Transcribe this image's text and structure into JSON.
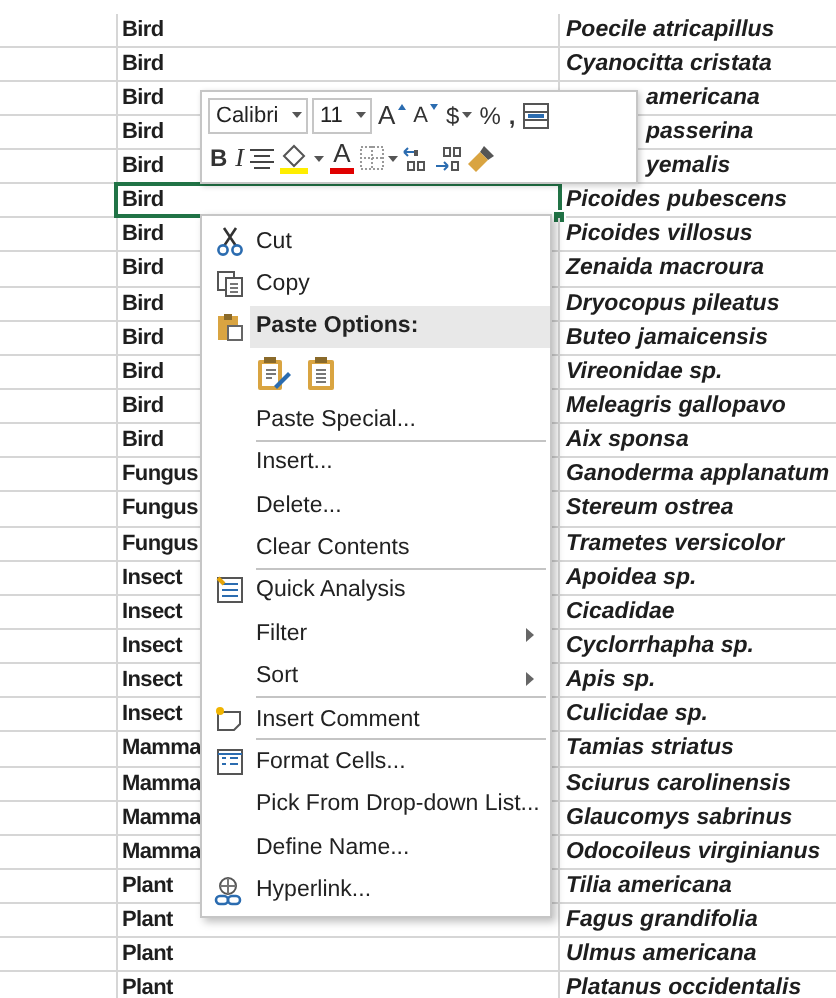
{
  "sheet": {
    "rows": [
      {
        "category": "Bird",
        "species": "Poecile atricapillus",
        "selected": false,
        "covered": false
      },
      {
        "category": "Bird",
        "species": "Cyanocitta cristata",
        "selected": false,
        "covered": false
      },
      {
        "category": "Bird",
        "species": "americana",
        "selected": false,
        "covered": true
      },
      {
        "category": "Bird",
        "species": "passerina",
        "selected": false,
        "covered": true
      },
      {
        "category": "Bird",
        "species": "yemalis",
        "selected": false,
        "covered": true
      },
      {
        "category": "Bird",
        "species": "Picoides pubescens",
        "selected": true,
        "covered": false
      },
      {
        "category": "Bird",
        "species": "Picoides villosus",
        "selected": false,
        "covered": false
      },
      {
        "category": "Bird",
        "species": "Zenaida macroura",
        "selected": false,
        "covered": false
      },
      {
        "category": "Bird",
        "species": "Dryocopus pileatus",
        "selected": false,
        "covered": false
      },
      {
        "category": "Bird",
        "species": "Buteo jamaicensis",
        "selected": false,
        "covered": false
      },
      {
        "category": "Bird",
        "species": "Vireonidae sp.",
        "selected": false,
        "covered": false
      },
      {
        "category": "Bird",
        "species": "Meleagris gallopavo",
        "selected": false,
        "covered": false
      },
      {
        "category": "Bird",
        "species": "Aix sponsa",
        "selected": false,
        "covered": false
      },
      {
        "category": "Fungus",
        "species": "Ganoderma applanatum",
        "selected": false,
        "covered": false
      },
      {
        "category": "Fungus",
        "species": "Stereum ostrea",
        "selected": false,
        "covered": false
      },
      {
        "category": "Fungus",
        "species": "Trametes versicolor",
        "selected": false,
        "covered": false
      },
      {
        "category": "Insect",
        "species": "Apoidea sp.",
        "selected": false,
        "covered": false
      },
      {
        "category": "Insect",
        "species": "Cicadidae",
        "selected": false,
        "covered": false
      },
      {
        "category": "Insect",
        "species": "Cyclorrhapha sp.",
        "selected": false,
        "covered": false
      },
      {
        "category": "Insect",
        "species": "Apis sp.",
        "selected": false,
        "covered": false
      },
      {
        "category": "Insect",
        "species": "Culicidae sp.",
        "selected": false,
        "covered": false
      },
      {
        "category": "Mamma",
        "species": "Tamias striatus",
        "selected": false,
        "covered": false
      },
      {
        "category": "Mamma",
        "species": "Sciurus carolinensis",
        "selected": false,
        "covered": false
      },
      {
        "category": "Mamma",
        "species": "Glaucomys sabrinus",
        "selected": false,
        "covered": false
      },
      {
        "category": "Mamma",
        "species": "Odocoileus virginianus",
        "selected": false,
        "covered": false
      },
      {
        "category": "Plant",
        "species": "Tilia americana",
        "selected": false,
        "covered": false
      },
      {
        "category": "Plant",
        "species": "Fagus grandifolia",
        "selected": false,
        "covered": false
      },
      {
        "category": "Plant",
        "species": "Ulmus americana",
        "selected": false,
        "covered": false
      },
      {
        "category": "Plant",
        "species": "Platanus occidentalis",
        "selected": false,
        "covered": false
      }
    ]
  },
  "mini_toolbar": {
    "rows": [
      {
        "items": [
          {
            "kind": "font",
            "label": "Calibri"
          },
          {
            "kind": "size",
            "label": "11"
          },
          {
            "kind": "grow",
            "label": "A"
          },
          {
            "kind": "shrink",
            "label": "A"
          },
          {
            "kind": "currency",
            "label": "$"
          },
          {
            "kind": "percent",
            "label": "%"
          },
          {
            "kind": "comma",
            "label": ","
          },
          {
            "kind": "table"
          }
        ]
      },
      {
        "items": [
          {
            "kind": "bold",
            "label": "B"
          },
          {
            "kind": "italic",
            "label": "I"
          },
          {
            "kind": "align"
          },
          {
            "kind": "fill",
            "color": "#ffee00"
          },
          {
            "kind": "fontcolor",
            "label": "A",
            "color": "#e00000"
          },
          {
            "kind": "borders"
          },
          {
            "kind": "incdec"
          },
          {
            "kind": "decdec"
          },
          {
            "kind": "painter"
          }
        ]
      }
    ]
  },
  "context_menu": {
    "items": [
      {
        "kind": "item",
        "label": "Cut",
        "submenu": false,
        "separator_after": false
      },
      {
        "kind": "item",
        "label": "Copy",
        "submenu": false,
        "separator_after": false
      },
      {
        "kind": "header",
        "label": "Paste Options:",
        "submenu": false,
        "separator_after": false
      },
      {
        "kind": "paste_options",
        "submenu": false,
        "separator_after": false
      },
      {
        "kind": "item",
        "label": "Paste Special...",
        "submenu": false,
        "separator_after": true
      },
      {
        "kind": "item",
        "label": "Insert...",
        "submenu": false,
        "separator_after": false
      },
      {
        "kind": "item",
        "label": "Delete...",
        "submenu": false,
        "separator_after": false
      },
      {
        "kind": "item",
        "label": "Clear Contents",
        "submenu": false,
        "separator_after": true
      },
      {
        "kind": "item",
        "label": "Quick Analysis",
        "submenu": false,
        "separator_after": false
      },
      {
        "kind": "item",
        "label": "Filter",
        "submenu": true,
        "separator_after": false
      },
      {
        "kind": "item",
        "label": "Sort",
        "submenu": true,
        "separator_after": true
      },
      {
        "kind": "item",
        "label": "Insert Comment",
        "submenu": false,
        "separator_after": true
      },
      {
        "kind": "item",
        "label": "Format Cells...",
        "submenu": false,
        "separator_after": false
      },
      {
        "kind": "item",
        "label": "Pick From Drop-down List...",
        "submenu": false,
        "separator_after": false
      },
      {
        "kind": "item",
        "label": "Define Name...",
        "submenu": false,
        "separator_after": false
      },
      {
        "kind": "item",
        "label": "Hyperlink...",
        "submenu": false,
        "separator_after": false
      }
    ]
  }
}
